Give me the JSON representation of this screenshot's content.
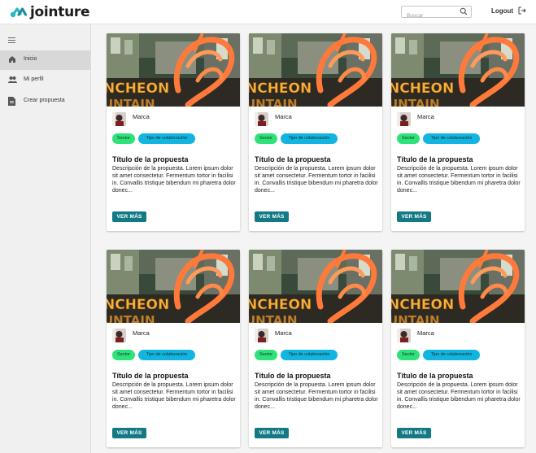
{
  "app": {
    "logo_text": "jointure",
    "brand_color": "#2ab7c4"
  },
  "header": {
    "search_placeholder": "Buscar",
    "logout_label": "Logout"
  },
  "sidebar": {
    "items": [
      {
        "label": "Inicio",
        "icon": "home-icon",
        "active": true
      },
      {
        "label": "Mi perfil",
        "icon": "people-icon",
        "active": false
      },
      {
        "label": "Crear propuesta",
        "icon": "document-icon",
        "active": false
      }
    ]
  },
  "cards": [
    {
      "brand": "Marca",
      "sector": "Sector",
      "tipo": "Tipo de colaboración",
      "title": "Título de la propuesta",
      "description": "Descripción de la propuesta. Lorem ipsum dolor sit amet consectetur. Fermentum tortor in facilisi in. Convallis tristique bibendum mi pharetra dolor donec...",
      "button": "VER MÁS"
    },
    {
      "brand": "Marca",
      "sector": "Sector",
      "tipo": "Tipo de colaboración",
      "title": "Título de la propuesta",
      "description": "Descripción de la propuesta. Lorem ipsum dolor sit amet consectetur. Fermentum tortor in facilisi in. Convallis tristique bibendum mi pharetra dolor donec...",
      "button": "VER MÁS"
    },
    {
      "brand": "Marca",
      "sector": "Sector",
      "tipo": "Tipo de colaboración",
      "title": "Título de la propuesta",
      "description": "Descripción de la propuesta. Lorem ipsum dolor sit amet consectetur. Fermentum tortor in facilisi in. Convallis tristique bibendum mi pharetra dolor donec...",
      "button": "VER MÁS"
    },
    {
      "brand": "Marca",
      "sector": "Sector",
      "tipo": "Tipo de colaboración",
      "title": "Título de la propuesta",
      "description": "Descripción de la propuesta. Lorem ipsum dolor sit amet consectetur. Fermentum tortor in facilisi in. Convallis tristique bibendum mi pharetra dolor donec...",
      "button": "VER MÁS"
    },
    {
      "brand": "Marca",
      "sector": "Sector",
      "tipo": "Tipo de colaboración",
      "title": "Título de la propuesta",
      "description": "Descripción de la propuesta. Lorem ipsum dolor sit amet consectetur. Fermentum tortor in facilisi in. Convallis tristique bibendum mi pharetra dolor donec...",
      "button": "VER MÁS"
    },
    {
      "brand": "Marca",
      "sector": "Sector",
      "tipo": "Tipo de colaboración",
      "title": "Título de la propuesta",
      "description": "Descripción de la propuesta. Lorem ipsum dolor sit amet consectetur. Fermentum tortor in facilisi in. Convallis tristique bibendum mi pharetra dolor donec...",
      "button": "VER MÁS"
    }
  ],
  "colors": {
    "sector_chip": "#2ee27a",
    "tipo_chip": "#12b5e0",
    "button": "#137a85"
  }
}
